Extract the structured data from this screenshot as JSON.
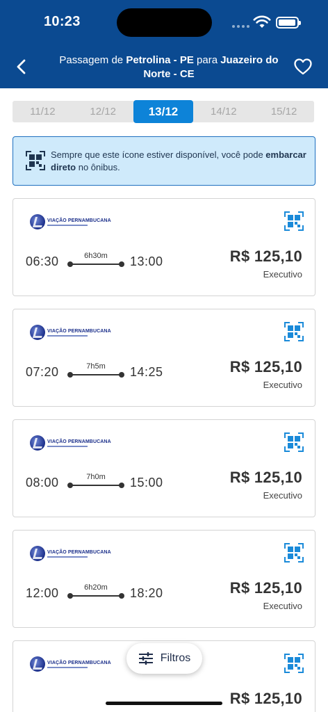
{
  "status_bar": {
    "time": "10:23"
  },
  "header": {
    "title_prefix": "Passagem de ",
    "origin": "Petrolina - PE",
    "connector": " para ",
    "destination": "Juazeiro do Norte - CE"
  },
  "date_tabs": [
    {
      "label": "11/12",
      "active": false
    },
    {
      "label": "12/12",
      "active": false
    },
    {
      "label": "13/12",
      "active": true
    },
    {
      "label": "14/12",
      "active": false
    },
    {
      "label": "15/12",
      "active": false
    }
  ],
  "info_banner": {
    "text_before": "Sempre que este ícone estiver disponível, você pode ",
    "text_bold": "embarcar direto",
    "text_after": " no ônibus."
  },
  "trips": [
    {
      "company": "VIAÇÃO PERNAMBUCANA",
      "departure": "06:30",
      "duration": "6h30m",
      "arrival": "13:00",
      "price": "R$ 125,10",
      "class": "Executivo"
    },
    {
      "company": "VIAÇÃO PERNAMBUCANA",
      "departure": "07:20",
      "duration": "7h5m",
      "arrival": "14:25",
      "price": "R$ 125,10",
      "class": "Executivo"
    },
    {
      "company": "VIAÇÃO PERNAMBUCANA",
      "departure": "08:00",
      "duration": "7h0m",
      "arrival": "15:00",
      "price": "R$ 125,10",
      "class": "Executivo"
    },
    {
      "company": "VIAÇÃO PERNAMBUCANA",
      "departure": "12:00",
      "duration": "6h20m",
      "arrival": "18:20",
      "price": "R$ 125,10",
      "class": "Executivo"
    },
    {
      "company": "VIAÇÃO PERNAMBUCANA",
      "departure": "",
      "duration": "",
      "arrival": "",
      "price": "R$ 125,10",
      "class": ""
    }
  ],
  "filter_button": {
    "label": "Filtros"
  },
  "colors": {
    "header_bg": "#0b4a91",
    "active_tab": "#0d83d8",
    "banner_bg": "#cfeafb",
    "qr_blue": "#1a8ad9"
  }
}
